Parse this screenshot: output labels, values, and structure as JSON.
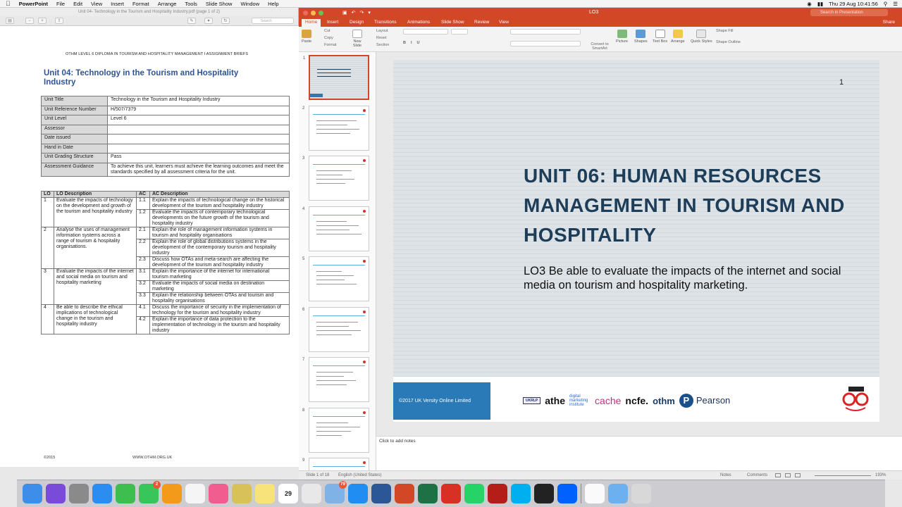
{
  "menubar": {
    "app": "PowerPoint",
    "items": [
      "File",
      "Edit",
      "View",
      "Insert",
      "Format",
      "Arrange",
      "Tools",
      "Slide Show",
      "Window",
      "Help"
    ],
    "clock": "Thu 29 Aug  10:41:56"
  },
  "preview": {
    "window_title": "Unit 04- Technology in the Tourism and Hospitality Industry.pdf (page 1 of 2)",
    "search_placeholder": "Search",
    "header": "OTHM LEVEL 6 DIPLOMA IN TOURISM AND HOSPITALITY MANAGEMENT I ASSIGNMENT BRIEFS",
    "title": "Unit 04: Technology in the Tourism and Hospitality Industry",
    "unit_table": [
      {
        "k": "Unit Title",
        "v": "Technology in the Tourism and Hospitality Industry"
      },
      {
        "k": "Unit Reference Number",
        "v": "H/507/7379"
      },
      {
        "k": "Unit Level",
        "v": "Level 6"
      },
      {
        "k": "Assessor",
        "v": ""
      },
      {
        "k": "Date issued",
        "v": ""
      },
      {
        "k": "Hand in Date",
        "v": ""
      },
      {
        "k": "Unit Grading Structure",
        "v": "Pass"
      },
      {
        "k": "Assessment Guidance",
        "v": "To achieve this unit, learners must achieve the learning outcomes and meet the standards specified by all assessment criteria for the unit."
      }
    ],
    "lo_headers": [
      "LO",
      "LO Description",
      "AC",
      "AC Description"
    ],
    "lo_rows": [
      {
        "lo": "1",
        "desc": "Evaluate the impacts of technology on the development and growth of the tourism and hospitality industry",
        "ac": [
          [
            "1.1",
            "Explain the impacts of technological change on the historical development of the tourism and hospitality industry"
          ],
          [
            "1.2",
            "Evaluate the impacts of contemporary technological developments on the future growth of the tourism and hospitality industry"
          ]
        ]
      },
      {
        "lo": "2",
        "desc": "Analyse the uses of management information systems across a range of tourism & hospitality organisations.",
        "ac": [
          [
            "2.1",
            "Explain the role of management information systems in tourism and hospitality organisations"
          ],
          [
            "2.2",
            "Explain the role of global distributions systems in the development of the contemporary tourism and hospitality industry"
          ],
          [
            "2.3",
            "Discuss how OTAs and meta-search are affecting the development of the tourism and hospitality industry"
          ]
        ]
      },
      {
        "lo": "3",
        "desc": "Evaluate the impacts of the internet and social media on tourism and hospitality marketing",
        "ac": [
          [
            "3.1",
            "Explain the importance of the internet for international tourism marketing"
          ],
          [
            "3.2",
            "Evaluate the impacts of social media on destination marketing"
          ],
          [
            "3.3",
            "Explain the relationship between OTAs and tourism and hospitality organisations"
          ]
        ]
      },
      {
        "lo": "4",
        "desc": "Be able to describe the ethical implications of technological change in the tourism and hospitality industry",
        "ac": [
          [
            "4.1",
            "Discuss the importance of security in the implementation of technology for the tourism and hospitality industry"
          ],
          [
            "4.2",
            "Explain the importance of data protection to the implementation of technology in the tourism and hospitality industry"
          ]
        ]
      }
    ],
    "footer_left": "©2015",
    "footer_right": "WWW.OTHM.ORG.UK"
  },
  "ppt": {
    "doc_title": "LO3",
    "search_placeholder": "Search in Presentation",
    "tabs": [
      "Home",
      "Insert",
      "Design",
      "Transitions",
      "Animations",
      "Slide Show",
      "Review",
      "View"
    ],
    "share": "Share",
    "ribbon": {
      "paste": "Paste",
      "cut": "Cut",
      "copy": "Copy",
      "format": "Format",
      "new_slide": "New Slide",
      "layout": "Layout",
      "reset": "Reset",
      "section": "Section",
      "convert": "Convert to SmartArt",
      "picture": "Picture",
      "shapes": "Shapes",
      "text_box": "Text Box",
      "arrange": "Arrange",
      "quick_styles": "Quick Styles",
      "shape_fill": "Shape Fill",
      "shape_outline": "Shape Outline"
    },
    "thumb_numbers": [
      "1",
      "2",
      "3",
      "4",
      "5",
      "6",
      "7",
      "8",
      "9"
    ],
    "slide": {
      "number": "1",
      "title": "UNIT 06: HUMAN RESOURCES MANAGEMENT IN TOURISM AND HOSPITALITY",
      "subtitle": "LO3 Be able to evaluate the impacts of the internet and social media on tourism and hospitality marketing.",
      "copyright": "©2017 UK Versity Online Limited",
      "logos": {
        "ukrlp": "UKRLP",
        "athe": "athe",
        "dmi": "digital marketing institute",
        "cache": "cache",
        "ncfe": "ncfe.",
        "othm": "othm",
        "pearson": "Pearson"
      }
    },
    "notes_placeholder": "Click to add notes",
    "status": {
      "slide": "Slide 1 of 18",
      "language": "English (United States)",
      "notes": "Notes",
      "comments": "Comments",
      "zoom": "193%"
    }
  },
  "dock": {
    "apps": [
      "Finder",
      "Siri",
      "System Preferences",
      "App Store",
      "FaceTime",
      "Messages",
      "iBooks",
      "Photos",
      "iTunes",
      "Notes",
      "Stickies",
      "Calendar",
      "Chrome",
      "Preview",
      "Safari",
      "Word",
      "PowerPoint",
      "Excel",
      "Acrobat",
      "WhatsApp",
      "FileZilla",
      "Skype",
      "Terminal",
      "Dropbox",
      "Documents",
      "Folder",
      "Trash"
    ],
    "calendar_day": "29",
    "messages_badge": "2",
    "preview_badge": "79"
  },
  "colors": {
    "ppt_accent": "#d24726",
    "slide_title": "#1e3d58",
    "doc_title": "#2f5496"
  }
}
